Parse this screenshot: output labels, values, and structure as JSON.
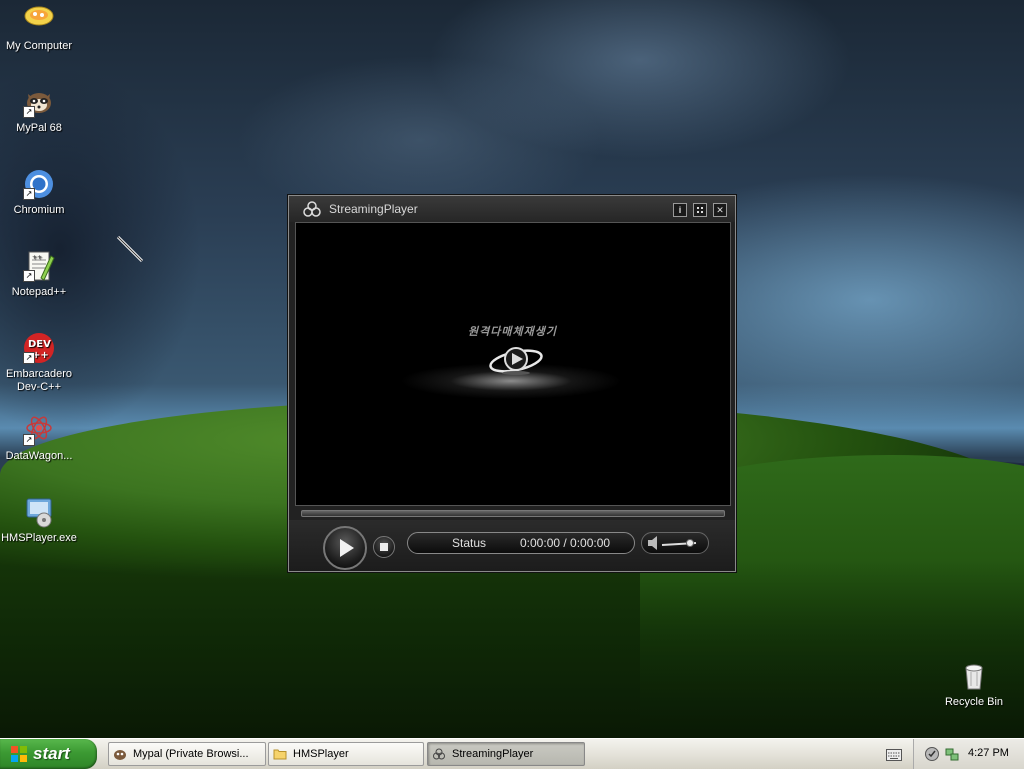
{
  "desktop": {
    "icons": [
      {
        "label": "My Computer",
        "icon": "my-computer-icon",
        "shortcut": false
      },
      {
        "label": "MyPal 68",
        "icon": "mypal-icon",
        "shortcut": true
      },
      {
        "label": "Chromium",
        "icon": "chromium-icon",
        "shortcut": true
      },
      {
        "label": "Notepad++",
        "icon": "notepad-plus-plus-icon",
        "shortcut": true
      },
      {
        "label": "Embarcadero Dev-C++",
        "label_line1": "Embarcadero",
        "label_line2": "Dev-C++",
        "icon": "dev-cpp-icon",
        "shortcut": true
      },
      {
        "label": "DataWagon...",
        "icon": "datawagon-icon",
        "shortcut": true
      },
      {
        "label": "HMSPlayer.exe",
        "icon": "hmsplayer-icon",
        "shortcut": false
      }
    ],
    "recycle_bin": {
      "label": "Recycle Bin",
      "icon": "recycle-bin-icon"
    }
  },
  "player": {
    "title": "StreamingPlayer",
    "buttons": {
      "info": "i",
      "fullscreen": "⛶",
      "close": "✕"
    },
    "logo_text": "원격다매체재생기",
    "status_label": "Status",
    "time": "0:00:00 / 0:00:00",
    "progress": 0
  },
  "taskbar": {
    "start_label": "start",
    "tasks": [
      {
        "label": "Mypal (Private Browsi...",
        "icon": "mypal-icon",
        "active": false
      },
      {
        "label": "HMSPlayer",
        "icon": "folder-icon",
        "active": false
      },
      {
        "label": "StreamingPlayer",
        "icon": "streamingplayer-icon",
        "active": true
      }
    ],
    "clock": "4:27 PM"
  },
  "colors": {
    "start_green": "#3c9a33",
    "taskbar_bg": "#e3e1d8",
    "player_bg": "#222222",
    "video_bg": "#000000"
  }
}
